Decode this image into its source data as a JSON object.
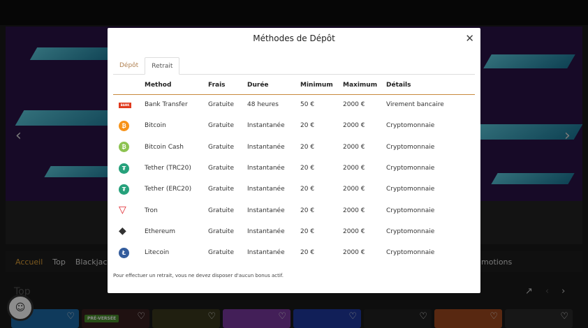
{
  "background": {
    "nav_items": [
      "Accueil",
      "Top",
      "Blackjack"
    ],
    "nav_right": "motions",
    "section_title": "Top",
    "tile_tag": "PRÉ-VERSÉE"
  },
  "modal": {
    "title": "Méthodes de Dépôt",
    "tabs": [
      {
        "label": "Dépôt",
        "active": false
      },
      {
        "label": "Retrait",
        "active": true
      }
    ],
    "columns": [
      "Method",
      "Frais",
      "Durée",
      "Minimum",
      "Maximum",
      "Détails"
    ],
    "rows": [
      {
        "icon": "bank-transfer-icon",
        "method": "Bank Transfer",
        "frais": "Gratuite",
        "duree": "48 heures",
        "min": "50 €",
        "max": "2000 €",
        "details": "Virement bancaire"
      },
      {
        "icon": "bitcoin-icon",
        "method": "Bitcoin",
        "frais": "Gratuite",
        "duree": "Instantanée",
        "min": "20 €",
        "max": "2000 €",
        "details": "Cryptomonnaie"
      },
      {
        "icon": "bitcoin-cash-icon",
        "method": "Bitcoin Cash",
        "frais": "Gratuite",
        "duree": "Instantanée",
        "min": "20 €",
        "max": "2000 €",
        "details": "Cryptomonnaie"
      },
      {
        "icon": "tether-icon",
        "method": "Tether (TRC20)",
        "frais": "Gratuite",
        "duree": "Instantanée",
        "min": "20 €",
        "max": "2000 €",
        "details": "Cryptomonnaie"
      },
      {
        "icon": "tether-icon",
        "method": "Tether (ERC20)",
        "frais": "Gratuite",
        "duree": "Instantanée",
        "min": "20 €",
        "max": "2000 €",
        "details": "Cryptomonnaie"
      },
      {
        "icon": "tron-icon",
        "method": "Tron",
        "frais": "Gratuite",
        "duree": "Instantanée",
        "min": "20 €",
        "max": "2000 €",
        "details": "Cryptomonnaie"
      },
      {
        "icon": "ethereum-icon",
        "method": "Ethereum",
        "frais": "Gratuite",
        "duree": "Instantanée",
        "min": "20 €",
        "max": "2000 €",
        "details": "Cryptomonnaie"
      },
      {
        "icon": "litecoin-icon",
        "method": "Litecoin",
        "frais": "Gratuite",
        "duree": "Instantanée",
        "min": "20 €",
        "max": "2000 €",
        "details": "Cryptomonnaie"
      }
    ],
    "footnote": "Pour effectuer un retrait, vous ne devez disposer d'aucun bonus actif."
  },
  "colors": {
    "accent": "#e1a137",
    "header_rule": "#c88a3d",
    "bitcoin": "#f7931a",
    "bitcoin_cash": "#8dc351",
    "tether": "#26a17b",
    "tron": "#e0232b",
    "litecoin": "#345d9d"
  }
}
